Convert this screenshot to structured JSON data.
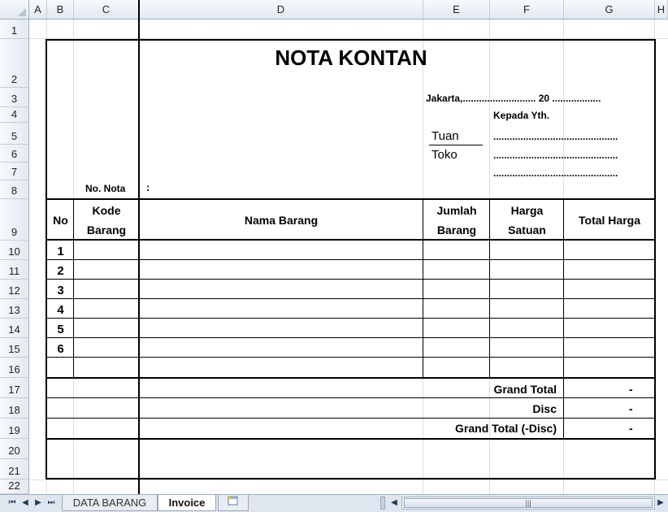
{
  "columns": [
    "A",
    "B",
    "C",
    "D",
    "E",
    "F",
    "G",
    "H"
  ],
  "rows": [
    "1",
    "2",
    "3",
    "4",
    "5",
    "6",
    "7",
    "8",
    "9",
    "10",
    "11",
    "12",
    "13",
    "14",
    "15",
    "16",
    "17",
    "18",
    "19",
    "20",
    "21",
    "22"
  ],
  "invoice": {
    "title": "NOTA KONTAN",
    "date_line": "Jakarta,........................... 20 ..................",
    "to_label": "Kepada Yth.",
    "tuan_label": "Tuan",
    "toko_label": "Toko",
    "dotted": "..............................................",
    "no_nota_label": "No. Nota",
    "no_nota_colon": ":",
    "headers": {
      "no": "No",
      "kode_1": "Kode",
      "kode_2": "Barang",
      "nama": "Nama Barang",
      "jumlah_1": "Jumlah",
      "jumlah_2": "Barang",
      "harga_1": "Harga",
      "harga_2": "Satuan",
      "total": "Total Harga"
    },
    "item_numbers": [
      "1",
      "2",
      "3",
      "4",
      "5",
      "6"
    ],
    "summary": [
      {
        "label": "Grand Total",
        "value": "-"
      },
      {
        "label": "Disc",
        "value": "-"
      },
      {
        "label": "Grand Total (-Disc)",
        "value": "-"
      }
    ]
  },
  "sheets": {
    "tabs": [
      "DATA BARANG",
      "Invoice"
    ],
    "active": "Invoice"
  },
  "icons": {
    "nav_first": "first-sheet-icon",
    "nav_prev": "prev-sheet-icon",
    "nav_next": "next-sheet-icon",
    "nav_last": "last-sheet-icon",
    "new_sheet": "insert-sheet-icon"
  }
}
